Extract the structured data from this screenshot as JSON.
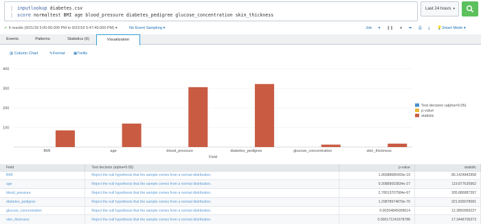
{
  "search": {
    "line1_cmd": "inputlookup",
    "line1_rest": "diabetes.csv",
    "line2_cmd": "score",
    "line2_rest": "normaltest BMI age blood_pressure diabetes_pedigree glucose_concentration skin_thickness"
  },
  "time_picker": {
    "label": "Last 24 hours"
  },
  "status": {
    "results": "6 results (9/21/18 5:00:00.000 PM to 9/22/18 5:47:40.000 PM)",
    "sampling": "No Event Sampling",
    "job": "Job",
    "smart_mode": "Smart Mode"
  },
  "tabs": [
    {
      "label": "Events"
    },
    {
      "label": "Patterns"
    },
    {
      "label": "Statistics (6)"
    },
    {
      "label": "Visualization"
    }
  ],
  "viz_toolbar": {
    "chart_type": "Column Chart",
    "format": "Format",
    "trellis": "Trellis"
  },
  "chart_data": {
    "type": "bar",
    "categories": [
      "BMI",
      "age",
      "blood_pressure",
      "diabetes_pedigree",
      "glucose_concentration",
      "skin_thickness"
    ],
    "series": [
      {
        "name": "Test decision (alpha=0.05)",
        "color": "#4a90c8",
        "values": [
          0,
          0,
          0,
          0,
          0,
          0
        ]
      },
      {
        "name": "p-value",
        "color": "#e6b83c",
        "values": [
          0,
          0,
          0,
          0,
          0,
          0
        ]
      },
      {
        "name": "statistic",
        "color": "#c95b43",
        "values": [
          85.14,
          119.88,
          305.89,
          321.84,
          12.39,
          17.34
        ]
      }
    ],
    "xlabel": "Field",
    "ylabel": "",
    "ylim": [
      0,
      400
    ],
    "yticks": [
      100,
      200,
      300,
      400
    ],
    "legend_position": "right"
  },
  "table": {
    "headers": [
      "Field",
      "Test decision (alpha=0.05)",
      "p-value",
      "statistic"
    ],
    "rows": [
      [
        "BMI",
        "Reject the null hypothesis that the sample comes from a normal distribution.",
        "1.96988685493e-19",
        "85.1424842958"
      ],
      [
        "age",
        "Reject the null hypothesis that the sample comes from a normal distribution.",
        "9.30889003834e-27",
        "119.877635962"
      ],
      [
        "blood_pressure",
        "Reject the null hypothesis that the sample comes from a normal distribution.",
        "2.78013707584e-67",
        "305.886887397"
      ],
      [
        "diabetes_pedigree",
        "Reject the null hypothesis that the sample comes from a normal distribution.",
        "1.29878974879e-70",
        "321.839078081"
      ],
      [
        "glucose_concentration",
        "Reject the null hypothesis that the sample comes from a normal distribution.",
        "0.00204845009614",
        "12.3850956227"
      ],
      [
        "skin_thickness",
        "Reject the null hypothesis that the sample comes from a normal distribution.",
        "0.000171241678788",
        "17.3448705373"
      ]
    ]
  }
}
